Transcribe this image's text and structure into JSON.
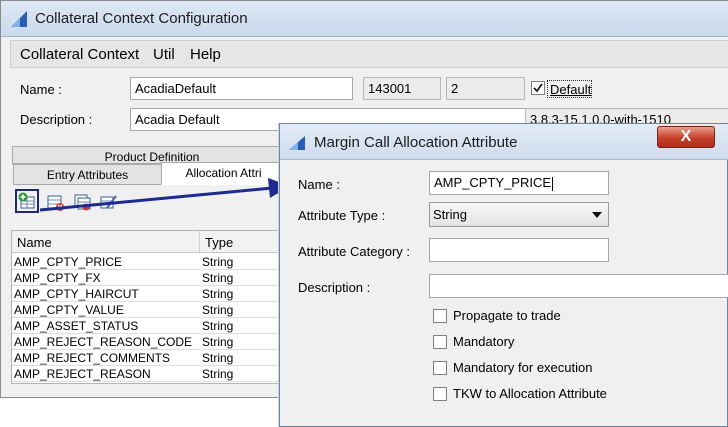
{
  "window": {
    "title": "Collateral Context Configuration",
    "menu": [
      "Collateral Context",
      "Util",
      "Help"
    ]
  },
  "form": {
    "name_label": "Name :",
    "name_value": "AcadiaDefault",
    "id_value": "143001",
    "version_value": "2",
    "default_label": "Default",
    "default_checked": true,
    "description_label": "Description :",
    "description_value": "Acadia Default",
    "build_value": "3.8.3-15.1.0.0-with-1510"
  },
  "tabs": {
    "outer": [
      "Product Definition"
    ],
    "inner": [
      "Entry Attributes",
      "Allocation Attri"
    ],
    "active_inner": "Allocation Attri"
  },
  "toolbar": {
    "icons": [
      "add-attribute-icon",
      "delete-attribute-icon",
      "copy-attribute-icon",
      "edit-attribute-icon"
    ]
  },
  "grid": {
    "columns": [
      "Name",
      "Type"
    ],
    "rows": [
      [
        "AMP_CPTY_PRICE",
        "String"
      ],
      [
        "AMP_CPTY_FX",
        "String"
      ],
      [
        "AMP_CPTY_HAIRCUT",
        "String"
      ],
      [
        "AMP_CPTY_VALUE",
        "String"
      ],
      [
        "AMP_ASSET_STATUS",
        "String"
      ],
      [
        "AMP_REJECT_REASON_CODE",
        "String"
      ],
      [
        "AMP_REJECT_COMMENTS",
        "String"
      ],
      [
        "AMP_REJECT_REASON",
        "String"
      ]
    ]
  },
  "dialog": {
    "title": "Margin Call Allocation Attribute",
    "close_label": "X",
    "name_label": "Name :",
    "name_value": "AMP_CPTY_PRICE",
    "type_label": "Attribute Type :",
    "type_value": "String",
    "category_label": "Attribute Category :",
    "category_value": "",
    "description_label": "Description :",
    "description_value": "",
    "checkboxes": [
      {
        "label": "Propagate to trade",
        "checked": false
      },
      {
        "label": "Mandatory",
        "checked": false
      },
      {
        "label": "Mandatory for execution",
        "checked": false
      },
      {
        "label": "TKW to Allocation Attribute",
        "checked": false
      }
    ]
  },
  "colors": {
    "arrow": "#1e2a8c",
    "title_gradient_top": "#dee8f4",
    "close_button": "#c6402a"
  }
}
